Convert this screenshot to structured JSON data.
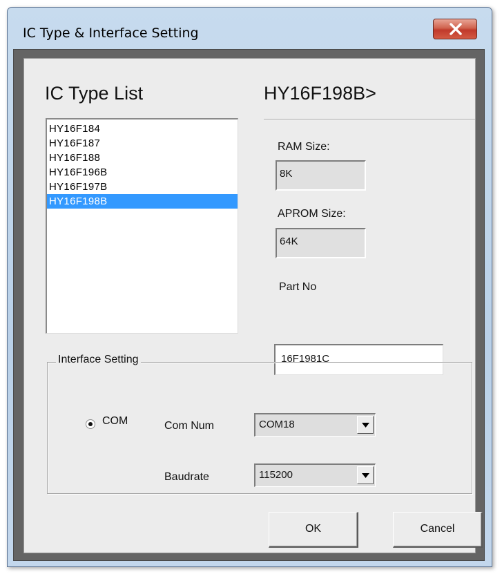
{
  "window": {
    "title": "IC Type & Interface Setting"
  },
  "ic_list": {
    "heading": "IC Type List",
    "items": [
      "HY16F184",
      "HY16F187",
      "HY16F188",
      "HY16F196B",
      "HY16F197B",
      "HY16F198B"
    ],
    "selected": "HY16F198B"
  },
  "chip_info": {
    "heading": "HY16F198B>",
    "ram_label": "RAM Size:",
    "ram_value": "8K",
    "aprom_label": "APROM Size:",
    "aprom_value": "64K",
    "part_label": "Part No",
    "part_value": "16F1981C"
  },
  "interface": {
    "group_title": "Interface Setting",
    "com_option_label": "COM",
    "com_selected": true,
    "com_num_label": "Com Num",
    "com_num_value": "COM18",
    "baudrate_label": "Baudrate",
    "baudrate_value": "115200"
  },
  "buttons": {
    "ok": "OK",
    "cancel": "Cancel"
  },
  "colors": {
    "selection": "#3399ff",
    "close_button": "#c0392b"
  }
}
